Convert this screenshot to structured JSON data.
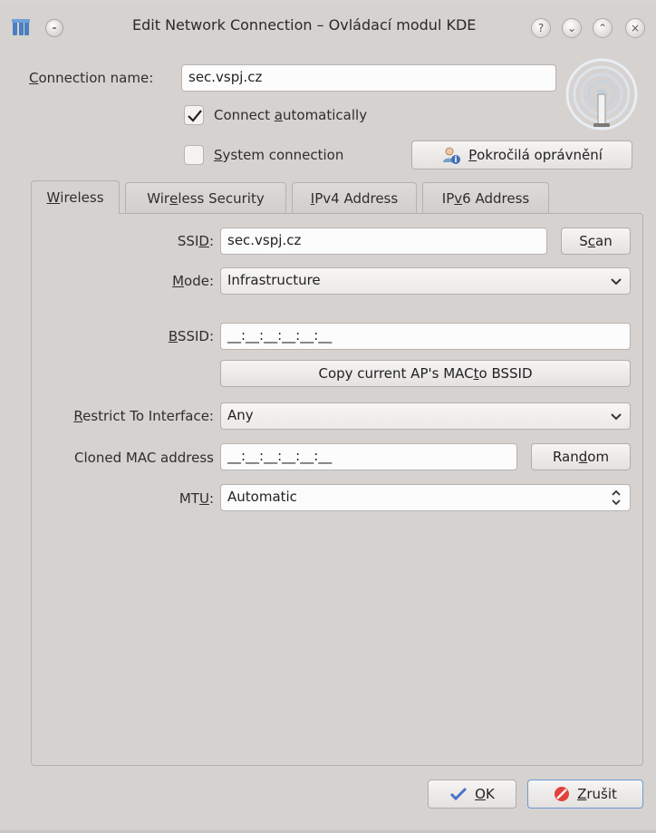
{
  "window": {
    "title": "Edit Network Connection – Ovládací modul KDE",
    "buttons": {
      "help": "?",
      "minimize": "⌄",
      "maximize": "⌃",
      "close": "×"
    }
  },
  "connection": {
    "name_label_u": "C",
    "name_label_rest": "onnection name:",
    "name_value": "sec.vspj.cz",
    "auto_pre": "Connect ",
    "auto_u": "a",
    "auto_post": "utomatically",
    "auto_checked": true,
    "system_u": "S",
    "system_rest": "ystem connection",
    "system_checked": false,
    "advanced_u": "P",
    "advanced_rest": "okročilá oprávnění"
  },
  "tabs": [
    {
      "u": "W",
      "rest": "ireless",
      "active": true
    },
    {
      "pre": "Wir",
      "u": "e",
      "rest": "less Security",
      "active": false
    },
    {
      "u": "I",
      "rest": "Pv4 Address",
      "active": false
    },
    {
      "pre": "IP",
      "u": "v",
      "rest": "6 Address",
      "active": false
    }
  ],
  "wireless": {
    "ssid_pre": "SSI",
    "ssid_u": "D",
    "ssid_post": ":",
    "ssid_value": "sec.vspj.cz",
    "scan_pre": "S",
    "scan_u": "c",
    "scan_post": "an",
    "mode_u": "M",
    "mode_rest": "ode:",
    "mode_value": "Infrastructure",
    "bssid_u": "B",
    "bssid_rest": "SSID:",
    "bssid_value": "__:__:__:__:__:__",
    "copy_pre": "Copy current AP's MAC ",
    "copy_u": "t",
    "copy_post": "o BSSID",
    "restrict_u": "R",
    "restrict_rest": "estrict To Interface:",
    "restrict_value": "Any",
    "cloned_label": "Cloned MAC address",
    "cloned_value": "__:__:__:__:__:__",
    "random_pre": "Ran",
    "random_u": "d",
    "random_post": "om",
    "mtu_pre": "MT",
    "mtu_u": "U",
    "mtu_post": ":",
    "mtu_value": "Automatic"
  },
  "footer": {
    "ok_u": "O",
    "ok_rest": "K",
    "cancel_u": "Z",
    "cancel_rest": "rušit"
  },
  "colors": {
    "background": "#d6d2d0",
    "cancel_icon": "#e0433b",
    "ok_check": "#4a73c9"
  }
}
